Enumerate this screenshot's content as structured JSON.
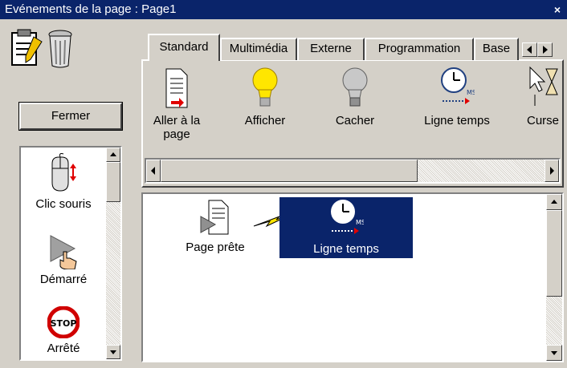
{
  "window": {
    "title": "Evénements de la page : Page1",
    "close_glyph": "×"
  },
  "toolbar_left": {
    "close_button": "Fermer"
  },
  "tabs": [
    {
      "label": "Standard",
      "active": true
    },
    {
      "label": "Multimédia"
    },
    {
      "label": "Externe"
    },
    {
      "label": "Programmation"
    },
    {
      "label": "Base"
    }
  ],
  "action_items": [
    {
      "label_line1": "Aller à la",
      "label_line2": "page",
      "icon": "page-arrow-icon"
    },
    {
      "label_line1": "Afficher",
      "icon": "lightbulb-on-icon"
    },
    {
      "label_line1": "Cacher",
      "icon": "lightbulb-off-icon"
    },
    {
      "label_line1": "Ligne temps",
      "icon": "timeline-clock-icon"
    },
    {
      "label_line1": "Curse",
      "icon": "cursor-hourglass-icon"
    }
  ],
  "event_list": [
    {
      "label": "Clic souris",
      "icon": "mouse-icon"
    },
    {
      "label": "Démarré",
      "icon": "play-hand-icon"
    },
    {
      "label": "Arrêté",
      "icon": "stop-icon"
    }
  ],
  "canvas_items": [
    {
      "label": "Page prête",
      "icon": "page-play-icon"
    },
    {
      "label": "Ligne temps",
      "icon": "timeline-clock-icon",
      "selected": true
    }
  ],
  "colors": {
    "titlebar": "#0a246a",
    "selection": "#0a246a",
    "face": "#d4d0c8"
  }
}
